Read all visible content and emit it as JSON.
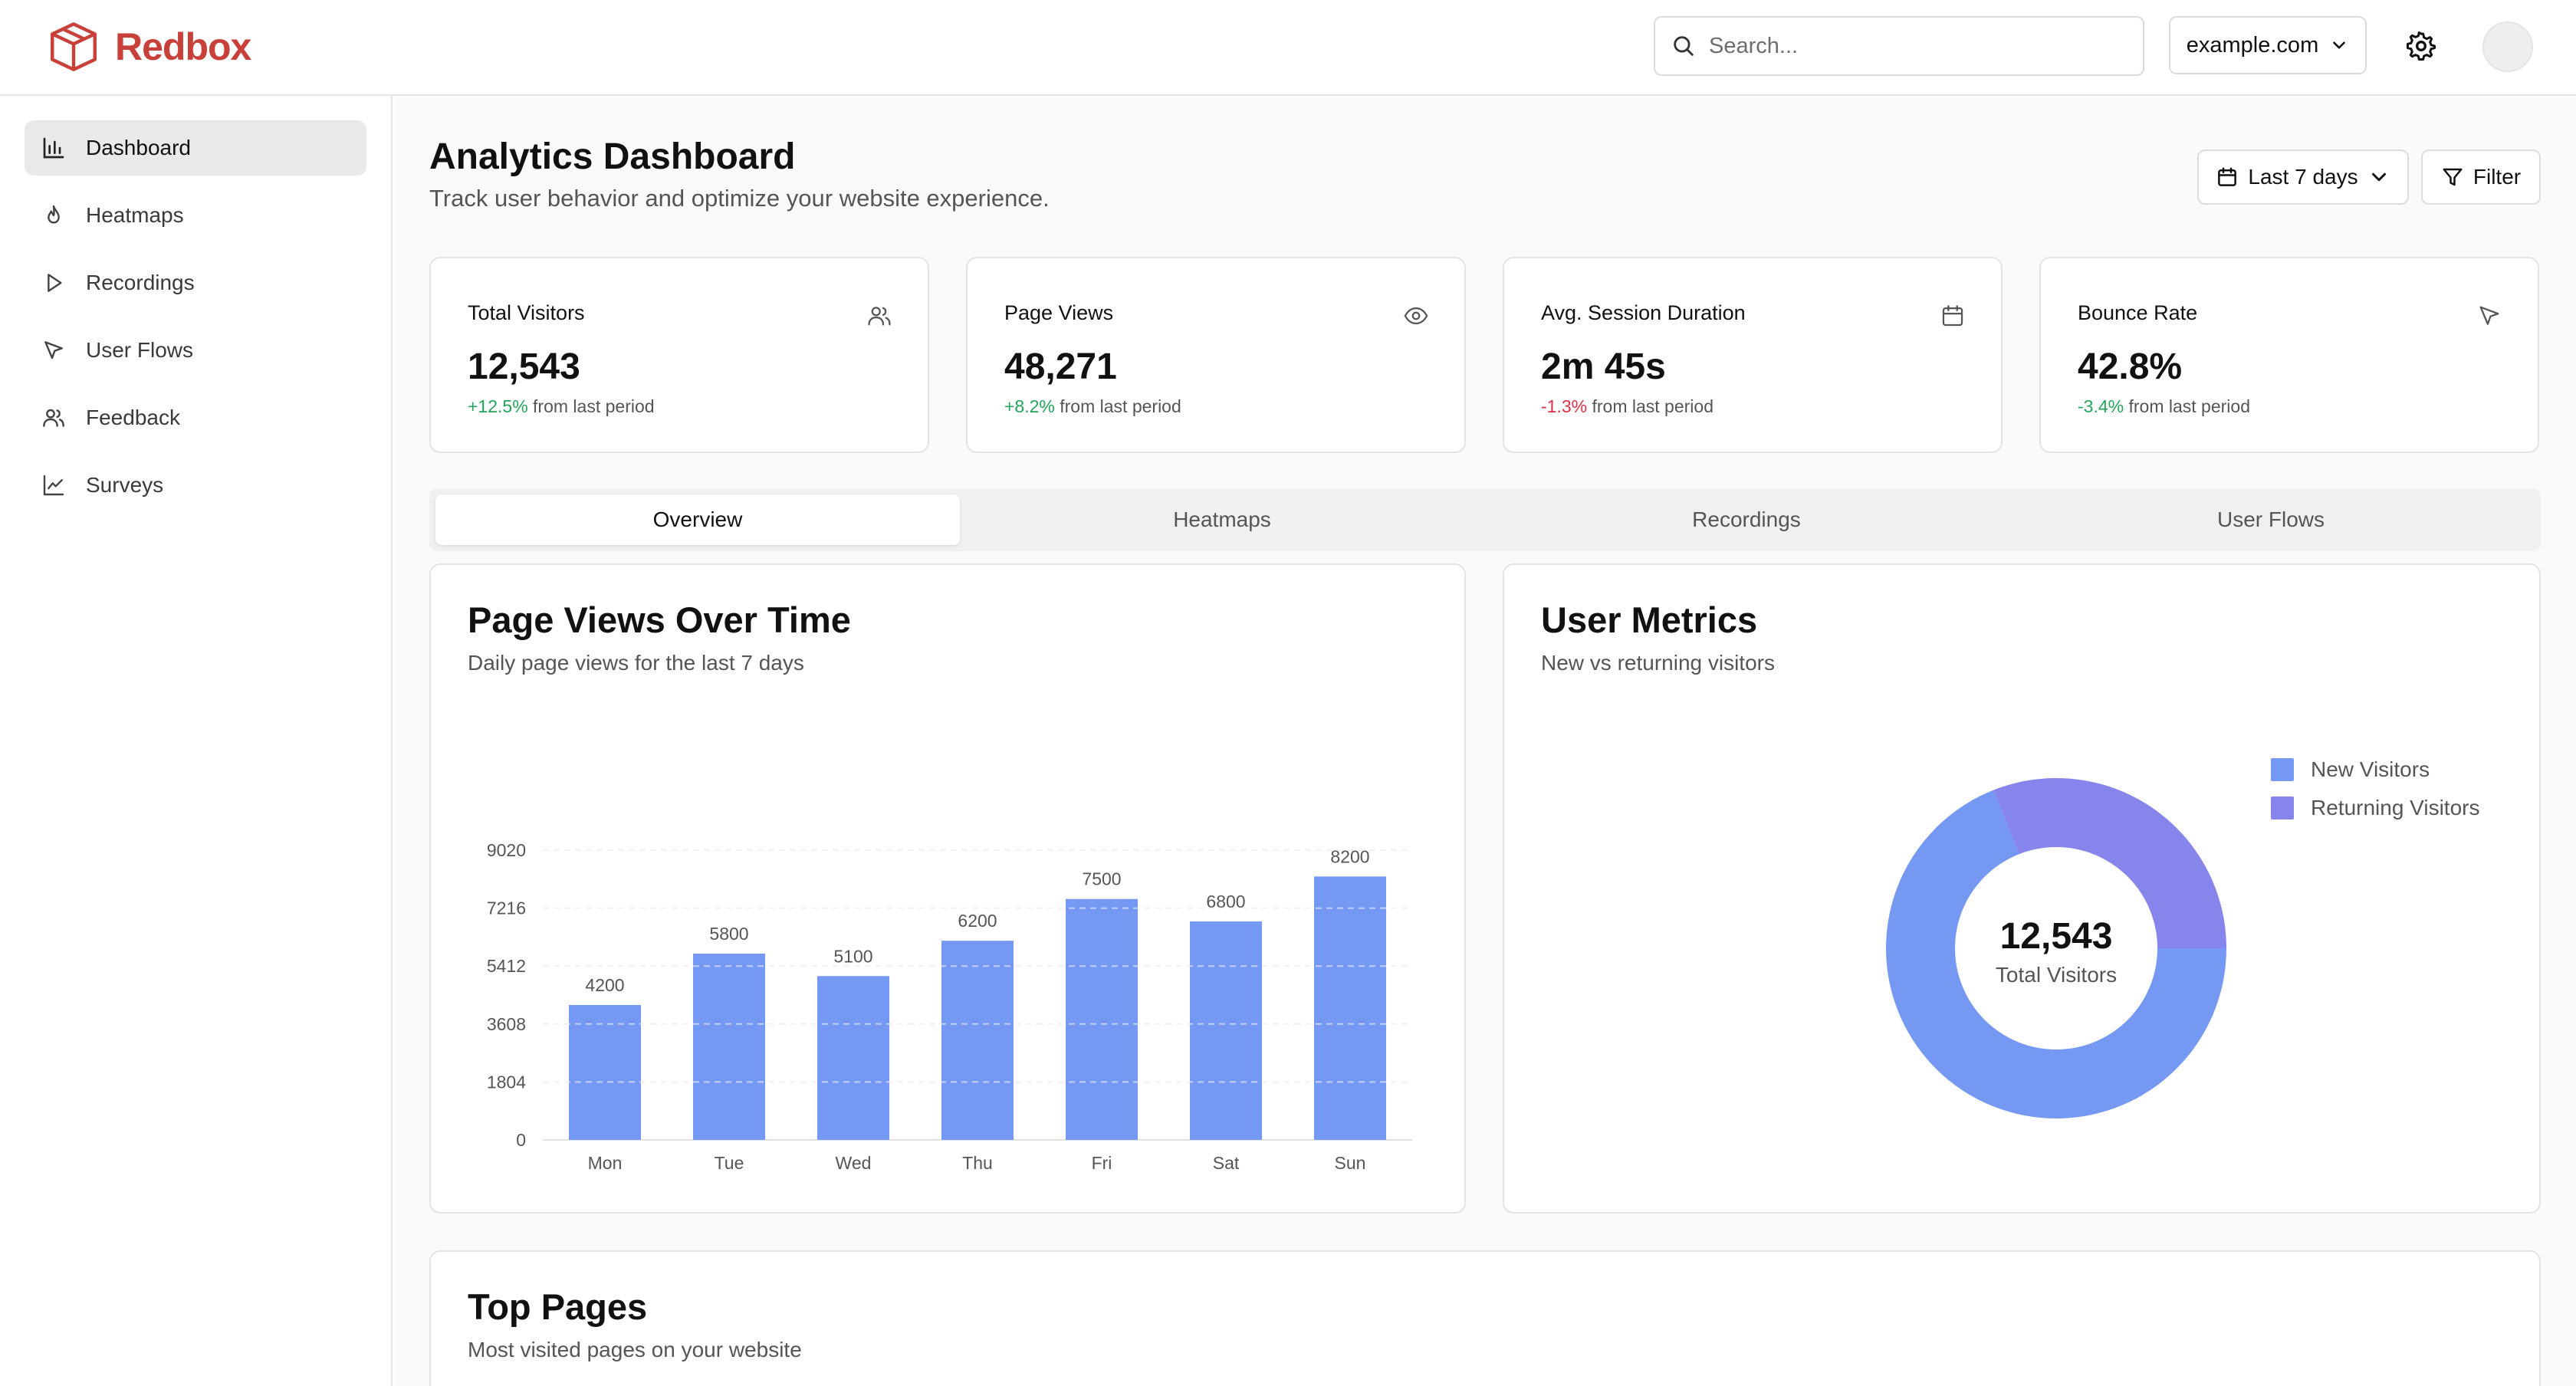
{
  "header": {
    "brand_name": "Redbox",
    "search_placeholder": "Search...",
    "domain": "example.com"
  },
  "sidebar": {
    "items": [
      {
        "label": "Dashboard",
        "icon": "bar-chart-icon",
        "active": true
      },
      {
        "label": "Heatmaps",
        "icon": "flame-icon"
      },
      {
        "label": "Recordings",
        "icon": "play-icon"
      },
      {
        "label": "User Flows",
        "icon": "cursor-icon"
      },
      {
        "label": "Feedback",
        "icon": "users-icon"
      },
      {
        "label": "Surveys",
        "icon": "line-chart-icon"
      }
    ]
  },
  "main": {
    "title": "Analytics Dashboard",
    "subtitle": "Track user behavior and optimize your website experience.",
    "date_range_label": "Last 7 days",
    "filter_label": "Filter",
    "stats": [
      {
        "label": "Total Visitors",
        "value": "12,543",
        "change": "+12.5%",
        "change_suffix": " from last period",
        "icon": "users-icon"
      },
      {
        "label": "Page Views",
        "value": "48,271",
        "change": "+8.2%",
        "change_suffix": " from last period",
        "icon": "eye-icon"
      },
      {
        "label": "Avg. Session Duration",
        "value": "2m 45s",
        "change": "-1.3%",
        "change_suffix": " from last period",
        "icon": "calendar-icon"
      },
      {
        "label": "Bounce Rate",
        "value": "42.8%",
        "change": "-3.4%",
        "change_suffix": " from last period",
        "icon": "cursor-icon"
      }
    ],
    "tabs": [
      "Overview",
      "Heatmaps",
      "Recordings",
      "User Flows"
    ],
    "active_tab": "Overview",
    "page_views_panel": {
      "title": "Page Views Over Time",
      "subtitle": "Daily page views for the last 7 days"
    },
    "user_metrics_panel": {
      "title": "User Metrics",
      "subtitle": "New vs returning visitors",
      "center_value": "12,543",
      "center_caption": "Total Visitors"
    },
    "top_pages_panel": {
      "title": "Top Pages",
      "subtitle": "Most visited pages on your website"
    }
  },
  "colors": {
    "brand": "#c8403a",
    "bar": "#7598f3",
    "new_visitors": "#7598f3",
    "returning_visitors": "#8585ec",
    "positive": "#22a55a",
    "negative": "#dc2f45"
  },
  "chart_data": [
    {
      "type": "bar",
      "categories": [
        "Mon",
        "Tue",
        "Wed",
        "Thu",
        "Fri",
        "Sat",
        "Sun"
      ],
      "values": [
        4200,
        5800,
        5100,
        6200,
        7500,
        6800,
        8200
      ],
      "yticks": [
        0,
        1804,
        3608,
        5412,
        7216,
        9020
      ],
      "ylim": [
        0,
        9020
      ],
      "grid": true
    },
    {
      "type": "pie",
      "labels": [
        "New Visitors",
        "Returning Visitors"
      ],
      "values": [
        69,
        31
      ],
      "legend": "top-right"
    }
  ]
}
